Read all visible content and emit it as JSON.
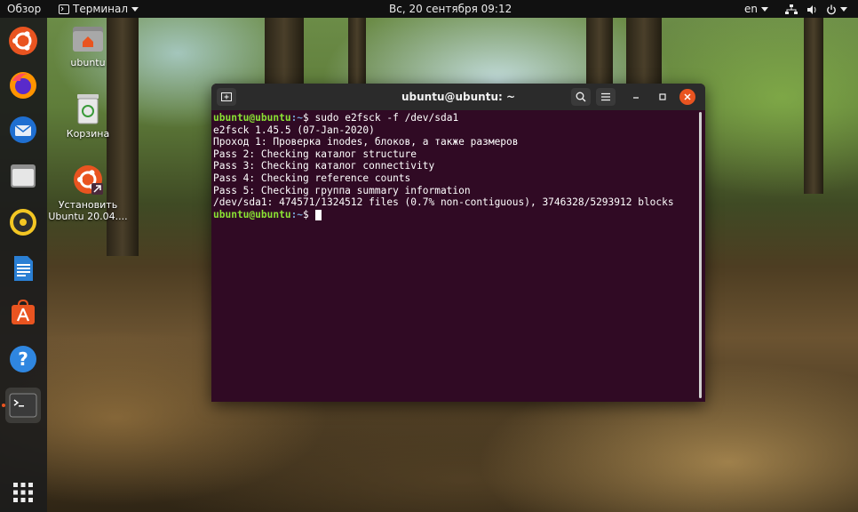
{
  "topbar": {
    "overview": "Обзор",
    "app_menu": "Терминал",
    "clock": "Вс, 20 сентября  09:12",
    "language": "en"
  },
  "desktop": {
    "icons": [
      {
        "label": "ubuntu"
      },
      {
        "label": "Корзина"
      },
      {
        "label": "Установить Ubuntu 20.04...."
      }
    ]
  },
  "dock": {
    "apps": [
      "ubuntu-logo-icon",
      "firefox-icon",
      "thunderbird-icon",
      "files-icon",
      "rhythmbox-icon",
      "writer-icon",
      "software-icon",
      "help-icon",
      "terminal-icon"
    ],
    "grid": "show-applications-icon"
  },
  "terminal": {
    "title": "ubuntu@ubuntu: ~",
    "prompt_user": "ubuntu@ubuntu",
    "prompt_path": ":~",
    "prompt_symbol": "$",
    "command": " sudo e2fsck -f /dev/sda1",
    "output": [
      "e2fsck 1.45.5 (07-Jan-2020)",
      "Проход 1: Проверка inodes, блоков, а также размеров",
      "Pass 2: Checking каталог structure",
      "Pass 3: Checking каталог connectivity",
      "Pass 4: Checking reference counts",
      "Pass 5: Checking группа summary information",
      "/dev/sda1: 474571/1324512 files (0.7% non-contiguous), 3746328/5293912 blocks"
    ]
  },
  "colors": {
    "terminal_bg": "#300a24",
    "prompt_user": "#8ae234",
    "prompt_path": "#729fcf",
    "close_button": "#e95420"
  }
}
